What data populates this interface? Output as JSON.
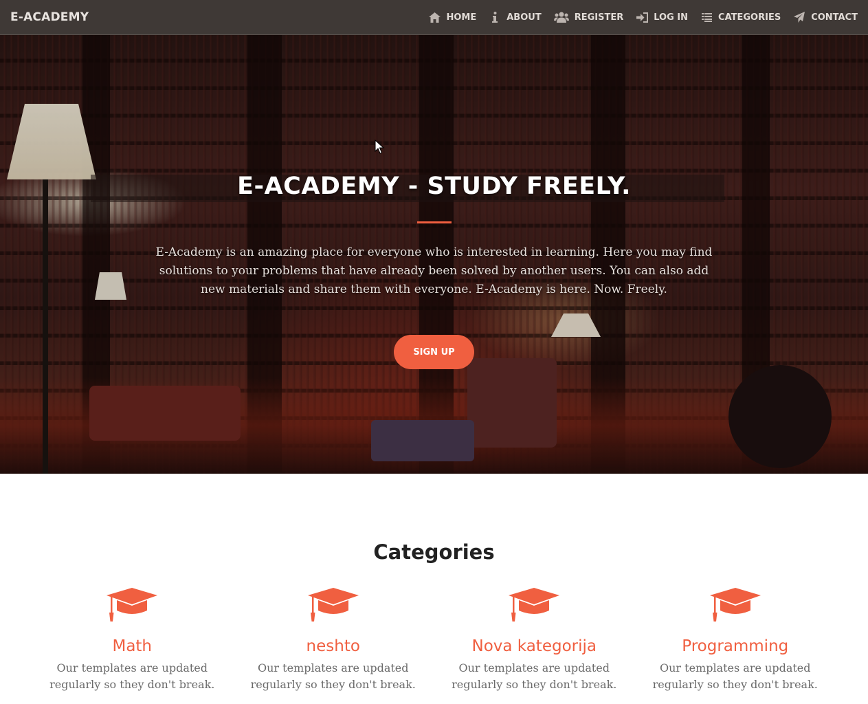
{
  "navbar": {
    "brand": "E-ACADEMY",
    "items": [
      {
        "label": "HOME",
        "icon": "home-icon"
      },
      {
        "label": "ABOUT",
        "icon": "info-icon"
      },
      {
        "label": "REGISTER",
        "icon": "users-icon"
      },
      {
        "label": "LOG IN",
        "icon": "login-icon"
      },
      {
        "label": "CATEGORIES",
        "icon": "list-icon"
      },
      {
        "label": "CONTACT",
        "icon": "send-icon"
      }
    ]
  },
  "hero": {
    "title": "E-ACADEMY - STUDY FREELY.",
    "text": "E-Academy is an amazing place for everyone who is interested in learning. Here you may find solutions to your problems that have already been solved by another users. You can also add new materials and share them with everyone. E-Academy is here. Now. Freely.",
    "button": "SIGN UP"
  },
  "categories": {
    "title": "Categories",
    "items": [
      {
        "name": "Math",
        "desc": "Our templates are updated regularly so they don't break.",
        "icon": "graduation-cap-icon"
      },
      {
        "name": "neshto",
        "desc": "Our templates are updated regularly so they don't break.",
        "icon": "graduation-cap-icon"
      },
      {
        "name": "Nova kategorija",
        "desc": "Our templates are updated regularly so they don't break.",
        "icon": "graduation-cap-icon"
      },
      {
        "name": "Programming",
        "desc": "Our templates are updated regularly so they don't break.",
        "icon": "graduation-cap-icon"
      }
    ]
  },
  "colors": {
    "accent": "#f05f40",
    "navbar": "#3f3936"
  }
}
